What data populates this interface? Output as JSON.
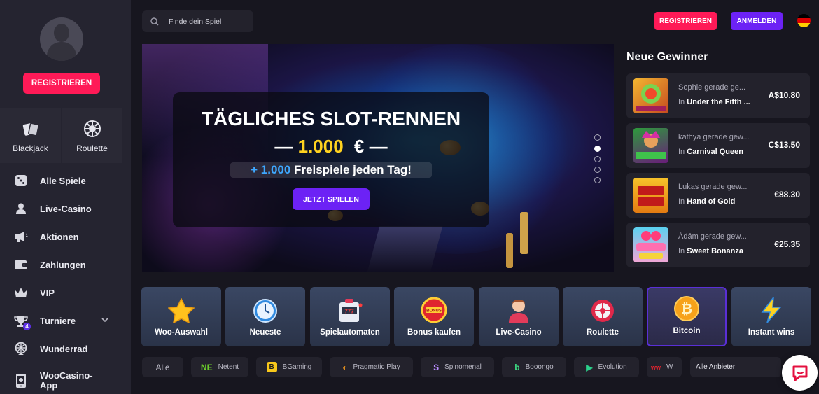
{
  "colors": {
    "accent_red": "#ff1a57",
    "accent_purple": "#6c22f5",
    "highlight_yellow": "#ffd21f",
    "highlight_blue": "#3ea8ff"
  },
  "sidebar": {
    "register_label": "REGISTRIEREN",
    "quick": [
      {
        "label": "Blackjack",
        "icon": "cards-icon"
      },
      {
        "label": "Roulette",
        "icon": "roulette-icon"
      }
    ],
    "items": [
      {
        "label": "Alle Spiele",
        "icon": "dice-icon"
      },
      {
        "label": "Live-Casino",
        "icon": "dealer-icon"
      },
      {
        "label": "Aktionen",
        "icon": "megaphone-icon"
      },
      {
        "label": "Zahlungen",
        "icon": "wallet-icon"
      },
      {
        "label": "VIP",
        "icon": "crown-icon"
      },
      {
        "label": "Turniere",
        "icon": "trophy-icon",
        "badge": "4"
      },
      {
        "label": "Wunderrad",
        "icon": "wheel-icon"
      },
      {
        "label": "WooCasino-App",
        "icon": "phone-icon"
      }
    ]
  },
  "header": {
    "search_placeholder": "Finde dein Spiel",
    "register_label": "REGISTRIEREN",
    "login_label": "ANMELDEN",
    "language": "German"
  },
  "banner": {
    "title": "TÄGLICHES SLOT-RENNEN",
    "amount_prefix": "—",
    "amount": "1.000",
    "currency": "€",
    "amount_suffix": "—",
    "sub_prefix": "+ 1.000",
    "sub_text": "Freispiele jeden Tag!",
    "cta": "JETZT SPIELEN",
    "slides": 5,
    "active_slide": 2
  },
  "winners": {
    "title": "Neue Gewinner",
    "rows": [
      {
        "name": "Sophie gerade ge...",
        "in": "In",
        "game": "Under the Fifth ...",
        "amount": "A$10.80"
      },
      {
        "name": "kathya gerade gew...",
        "in": "In",
        "game": "Carnival Queen",
        "amount": "C$13.50"
      },
      {
        "name": "Lukas gerade gew...",
        "in": "In",
        "game": "Hand of Gold",
        "amount": "€88.30"
      },
      {
        "name": "Ádám gerade gew...",
        "in": "In",
        "game": "Sweet Bonanza",
        "amount": "€25.35"
      }
    ]
  },
  "categories": [
    {
      "label": "Woo-Auswahl",
      "icon": "star-icon"
    },
    {
      "label": "Neueste",
      "icon": "clock-icon"
    },
    {
      "label": "Spielautomaten",
      "icon": "slot-machine-icon"
    },
    {
      "label": "Bonus kaufen",
      "icon": "bonus-icon"
    },
    {
      "label": "Live-Casino",
      "icon": "dealer-icon"
    },
    {
      "label": "Roulette",
      "icon": "roulette-icon"
    },
    {
      "label": "Bitcoin",
      "icon": "bitcoin-icon"
    },
    {
      "label": "Instant wins",
      "icon": "lightning-icon"
    }
  ],
  "providers": {
    "items": [
      {
        "label": "Alle"
      },
      {
        "label": "Netent",
        "mark": "NE"
      },
      {
        "label": "BGaming",
        "mark": "B"
      },
      {
        "label": "Pragmatic Play",
        "mark": "◐"
      },
      {
        "label": "Spinomenal",
        "mark": "S"
      },
      {
        "label": "Booongo",
        "mark": "b"
      },
      {
        "label": "Evolution",
        "mark": "▶"
      },
      {
        "label": "W",
        "mark": "ww"
      }
    ],
    "all_label": "Alle Anbieter"
  }
}
